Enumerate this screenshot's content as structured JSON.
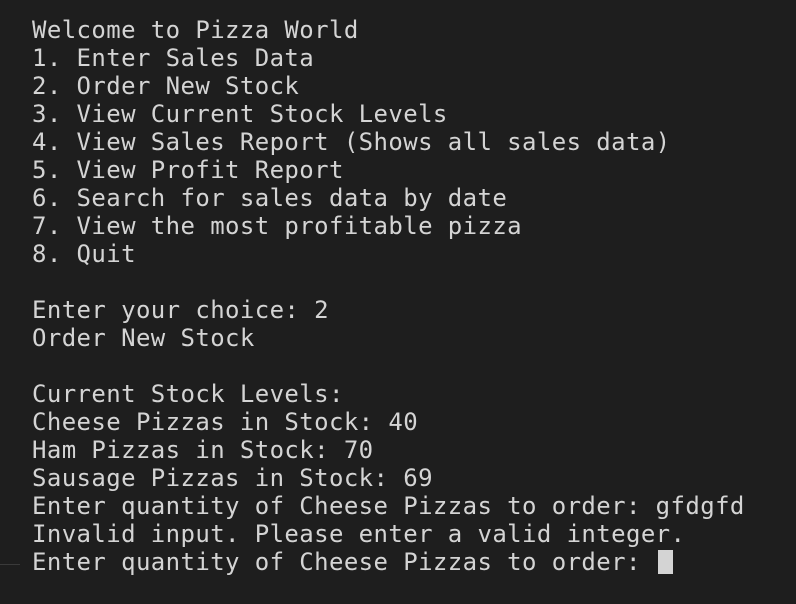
{
  "terminal": {
    "menu_title": "Welcome to Pizza World",
    "menu_items": [
      "1. Enter Sales Data",
      "2. Order New Stock",
      "3. View Current Stock Levels",
      "4. View Sales Report (Shows all sales data)",
      "5. View Profit Report",
      "6. Search for sales data by date",
      "7. View the most profitable pizza",
      "8. Quit"
    ],
    "choice_prompt": "Enter your choice: 2",
    "choice_result": "Order New Stock",
    "stock_header": "Current Stock Levels:",
    "stock_lines": [
      "Cheese Pizzas in Stock: 40",
      "Ham Pizzas in Stock: 70",
      "Sausage Pizzas in Stock: 69"
    ],
    "order_prompt_with_input": "Enter quantity of Cheese Pizzas to order: gfdgfd",
    "error_message": "Invalid input. Please enter a valid integer.",
    "order_prompt_active": "Enter quantity of Cheese Pizzas to order: "
  }
}
